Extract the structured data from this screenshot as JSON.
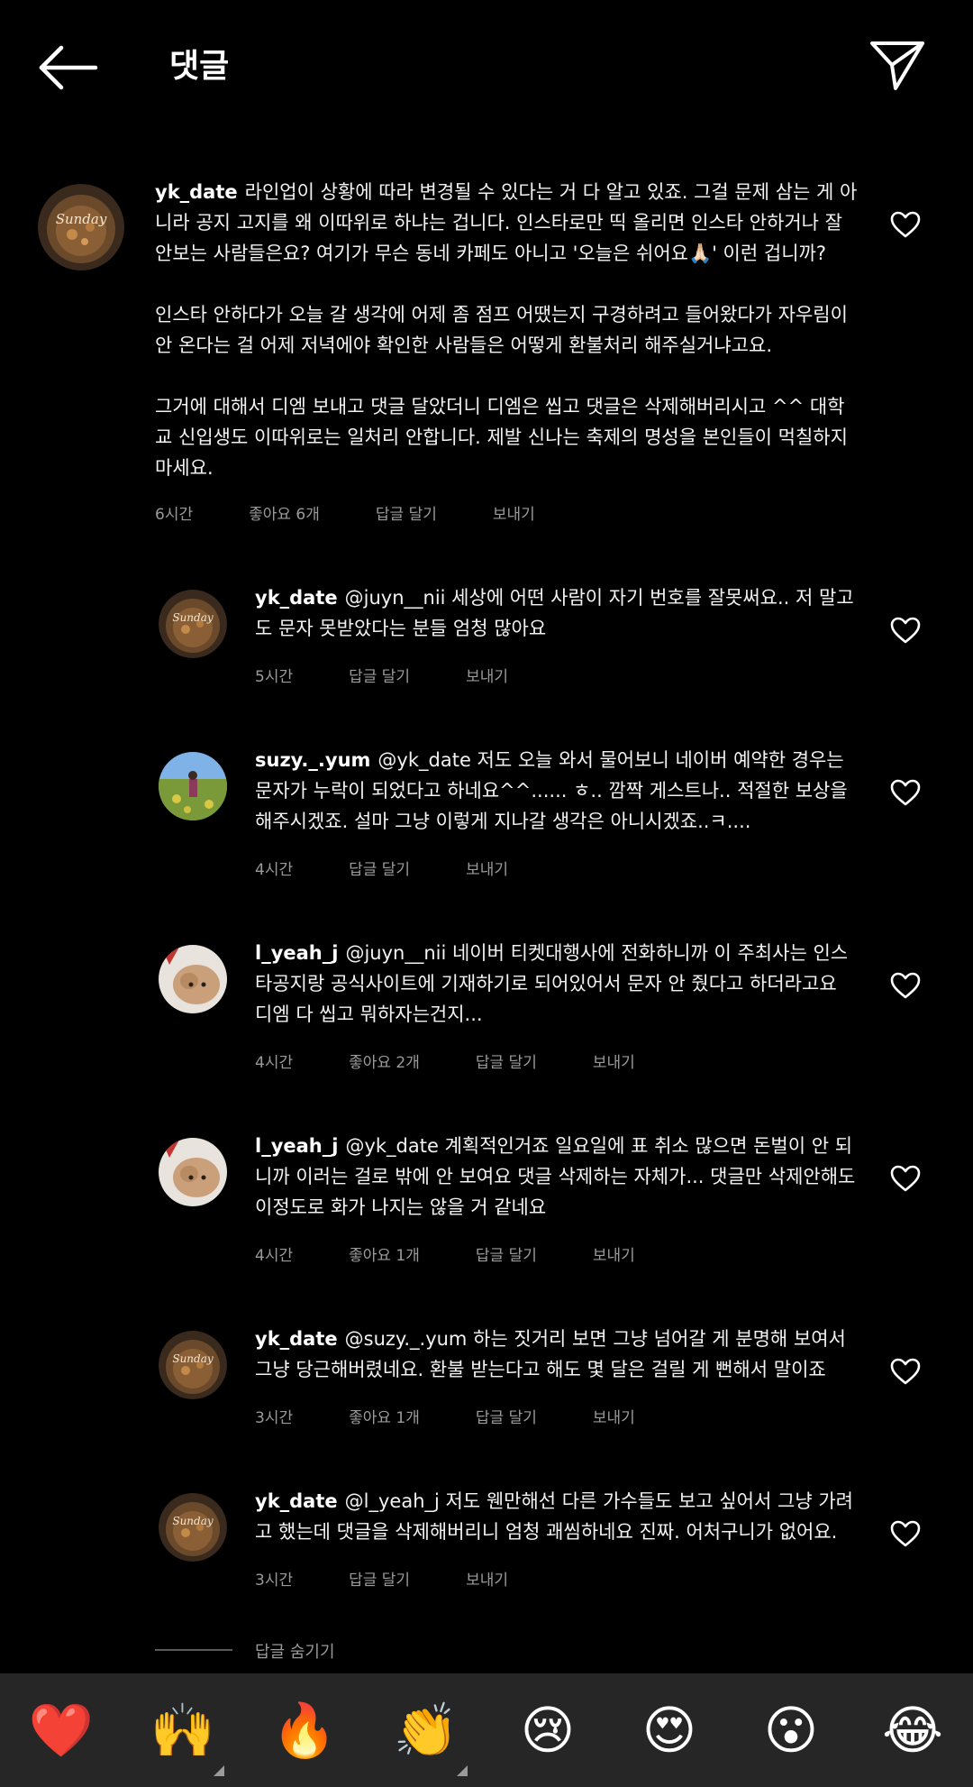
{
  "header": {
    "title": "댓글"
  },
  "main_comment": {
    "username": "yk_date",
    "paragraphs": [
      "라인업이 상황에 따라 변경될 수 있다는 거 다 알고 있죠. 그걸 문제 삼는 게 아니라 공지 고지를 왜 이따위로 하냐는 겁니다. 인스타로만 띡 올리면 인스타 안하거나 잘 안보는 사람들은요? 여기가 무슨 동네 카페도 아니고 '오늘은 쉬어요🙏🏻' 이런 겁니까?",
      "인스타 안하다가 오늘 갈 생각에 어제 좀 점프 어땠는지 구경하려고 들어왔다가 자우림이 안 온다는 걸 어제 저녁에야 확인한 사람들은 어떻게 환불처리 해주실거냐고요.",
      "그거에 대해서 디엠 보내고 댓글 달았더니 디엠은 씹고 댓글은 삭제해버리시고 ^^ 대학교 신입생도 이따위로는 일처리 안합니다. 제발 신나는 축제의 명성을 본인들이 먹칠하지 마세요."
    ],
    "time": "6시간",
    "likes": "좋아요 6개",
    "reply": "답글 달기",
    "send": "보내기"
  },
  "replies": [
    {
      "username": "yk_date",
      "text": "@juyn__nii 세상에 어떤 사람이 자기 번호를 잘못써요.. 저 말고도 문자 못받았다는 분들 엄청 많아요",
      "time": "5시간",
      "likes": "",
      "reply": "답글 달기",
      "send": "보내기"
    },
    {
      "username": "suzy._.yum",
      "text": "@yk_date 저도 오늘 와서 물어보니 네이버 예약한 경우는 문자가 누락이 되었다고 하네요^^...... ㅎ.. 깜짝 게스트나.. 적절한 보상을 해주시겠죠. 설마 그냥 이렇게 지나갈 생각은 아니시겠죠..ㅋ....",
      "time": "4시간",
      "likes": "",
      "reply": "답글 달기",
      "send": "보내기"
    },
    {
      "username": "l_yeah_j",
      "text": "@juyn__nii 네이버 티켓대행사에 전화하니까 이 주최사는 인스타공지랑 공식사이트에 기재하기로 되어있어서 문자 안 줬다고 하더라고요 디엠 다 씹고 뭐하자는건지...",
      "time": "4시간",
      "likes": "좋아요 2개",
      "reply": "답글 달기",
      "send": "보내기"
    },
    {
      "username": "l_yeah_j",
      "text": "@yk_date 계획적인거죠 일요일에 표 취소 많으면 돈벌이 안 되니까 이러는 걸로 밖에 안 보여요 댓글 삭제하는 자체가... 댓글만 삭제안해도 이정도로 화가 나지는 않을 거 같네요",
      "time": "4시간",
      "likes": "좋아요 1개",
      "reply": "답글 달기",
      "send": "보내기"
    },
    {
      "username": "yk_date",
      "text": "@suzy._.yum 하는 짓거리 보면 그냥 넘어갈 게 분명해 보여서 그냥 당근해버렸네요. 환불 받는다고 해도 몇 달은 걸릴 게 뻔해서 말이죠",
      "time": "3시간",
      "likes": "좋아요 1개",
      "reply": "답글 달기",
      "send": "보내기"
    },
    {
      "username": "yk_date",
      "text": "@l_yeah_j 저도 웬만해선 다른 가수들도 보고 싶어서 그냥 가려고 했는데 댓글을 삭제해버리니 엄청 괘씸하네요 진짜. 어처구니가 없어요.",
      "time": "3시간",
      "likes": "",
      "reply": "답글 달기",
      "send": "보내기"
    }
  ],
  "hide_replies": "답글 숨기기",
  "emojis": [
    "❤️",
    "🙌",
    "🔥",
    "👏",
    "😢",
    "😍",
    "😮",
    "😂"
  ],
  "icons": {
    "back": "arrow-left-icon",
    "send": "paper-plane-icon",
    "like": "heart-outline-icon"
  },
  "colors": {
    "background": "#000000",
    "text": "#ffffff",
    "muted": "#9a9a9a",
    "emoji_bar": "#262626"
  }
}
